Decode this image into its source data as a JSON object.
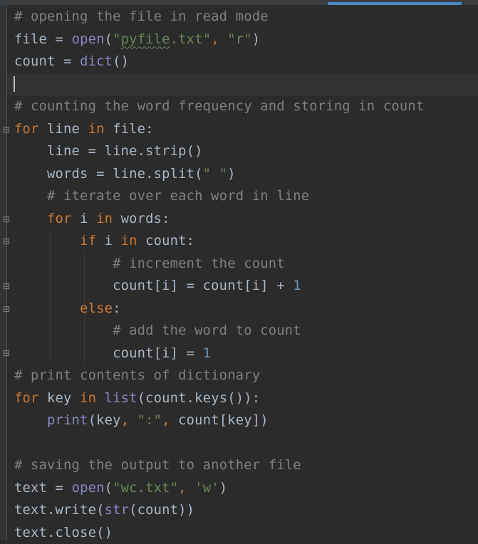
{
  "editor": {
    "language": "python",
    "theme": "dark",
    "lines": [
      {
        "id": "l1",
        "tokens": [
          {
            "t": "comment",
            "v": "# opening the file in read mode"
          }
        ]
      },
      {
        "id": "l2",
        "tokens": [
          {
            "t": "plain",
            "v": "file = "
          },
          {
            "t": "fn",
            "v": "open"
          },
          {
            "t": "plain",
            "v": "("
          },
          {
            "t": "str",
            "v": "\""
          },
          {
            "t": "str_sq",
            "v": "pyfile"
          },
          {
            "t": "str",
            "v": ".txt\""
          },
          {
            "t": "punct",
            "v": ", "
          },
          {
            "t": "str",
            "v": "\"r\""
          },
          {
            "t": "plain",
            "v": ")"
          }
        ]
      },
      {
        "id": "l3",
        "tokens": [
          {
            "t": "plain",
            "v": "count = "
          },
          {
            "t": "fn",
            "v": "dict"
          },
          {
            "t": "plain",
            "v": "()"
          }
        ]
      },
      {
        "id": "l4",
        "tokens": [
          {
            "t": "plain",
            "v": ""
          }
        ]
      },
      {
        "id": "l5",
        "tokens": [
          {
            "t": "comment",
            "v": "# counting the word frequency and storing in count"
          }
        ]
      },
      {
        "id": "l6",
        "tokens": [
          {
            "t": "kw",
            "v": "for "
          },
          {
            "t": "plain",
            "v": "line "
          },
          {
            "t": "kw",
            "v": "in "
          },
          {
            "t": "plain",
            "v": "file:"
          }
        ]
      },
      {
        "id": "l7",
        "tokens": [
          {
            "t": "plain",
            "v": "    line = line.strip()"
          }
        ]
      },
      {
        "id": "l8",
        "tokens": [
          {
            "t": "plain",
            "v": "    words = line.split("
          },
          {
            "t": "str",
            "v": "\" \""
          },
          {
            "t": "plain",
            "v": ")"
          }
        ]
      },
      {
        "id": "l9",
        "tokens": [
          {
            "t": "comment",
            "v": "    # iterate over each word in line"
          }
        ]
      },
      {
        "id": "l10",
        "tokens": [
          {
            "t": "plain",
            "v": "    "
          },
          {
            "t": "kw",
            "v": "for "
          },
          {
            "t": "plain",
            "v": "i "
          },
          {
            "t": "kw",
            "v": "in "
          },
          {
            "t": "plain",
            "v": "words:"
          }
        ]
      },
      {
        "id": "l11",
        "tokens": [
          {
            "t": "plain",
            "v": "        "
          },
          {
            "t": "kw",
            "v": "if "
          },
          {
            "t": "plain",
            "v": "i "
          },
          {
            "t": "kw",
            "v": "in "
          },
          {
            "t": "plain",
            "v": "count:"
          }
        ]
      },
      {
        "id": "l12",
        "tokens": [
          {
            "t": "comment",
            "v": "            # increment the count"
          }
        ]
      },
      {
        "id": "l13",
        "tokens": [
          {
            "t": "plain",
            "v": "            count[i] = count[i] + "
          },
          {
            "t": "num",
            "v": "1"
          }
        ]
      },
      {
        "id": "l14",
        "tokens": [
          {
            "t": "plain",
            "v": "        "
          },
          {
            "t": "kw",
            "v": "else"
          },
          {
            "t": "plain",
            "v": ":"
          }
        ]
      },
      {
        "id": "l15",
        "tokens": [
          {
            "t": "comment",
            "v": "            # add the word to count"
          }
        ]
      },
      {
        "id": "l16",
        "tokens": [
          {
            "t": "plain",
            "v": "            count[i] = "
          },
          {
            "t": "num",
            "v": "1"
          }
        ]
      },
      {
        "id": "l17",
        "tokens": [
          {
            "t": "comment",
            "v": "# print contents of dictionary"
          }
        ]
      },
      {
        "id": "l18",
        "tokens": [
          {
            "t": "kw",
            "v": "for "
          },
          {
            "t": "plain",
            "v": "key "
          },
          {
            "t": "kw",
            "v": "in "
          },
          {
            "t": "fn",
            "v": "list"
          },
          {
            "t": "plain",
            "v": "(count.keys()):"
          }
        ]
      },
      {
        "id": "l19",
        "tokens": [
          {
            "t": "plain",
            "v": "    "
          },
          {
            "t": "fn",
            "v": "print"
          },
          {
            "t": "plain",
            "v": "(key"
          },
          {
            "t": "punct",
            "v": ", "
          },
          {
            "t": "str",
            "v": "\":\""
          },
          {
            "t": "punct",
            "v": ", "
          },
          {
            "t": "plain",
            "v": "count[key])"
          }
        ]
      },
      {
        "id": "l20",
        "tokens": [
          {
            "t": "plain",
            "v": ""
          }
        ]
      },
      {
        "id": "l21",
        "tokens": [
          {
            "t": "comment",
            "v": "# saving the output to another file"
          }
        ]
      },
      {
        "id": "l22",
        "tokens": [
          {
            "t": "plain",
            "v": "text = "
          },
          {
            "t": "fn",
            "v": "open"
          },
          {
            "t": "plain",
            "v": "("
          },
          {
            "t": "str",
            "v": "\"wc.txt\""
          },
          {
            "t": "punct",
            "v": ", "
          },
          {
            "t": "str",
            "v": "'w'"
          },
          {
            "t": "plain",
            "v": ")"
          }
        ]
      },
      {
        "id": "l23",
        "tokens": [
          {
            "t": "plain",
            "v": "text.write("
          },
          {
            "t": "fn",
            "v": "str"
          },
          {
            "t": "plain",
            "v": "(count))"
          }
        ]
      },
      {
        "id": "l24",
        "tokens": [
          {
            "t": "plain",
            "v": "text.close()"
          }
        ]
      }
    ]
  },
  "colors": {
    "background": "#2b2b2b",
    "comment": "#808080",
    "keyword": "#cc7832",
    "builtin": "#8888c6",
    "string": "#6a8759",
    "number": "#6897bb",
    "text": "#a9b7c6",
    "scroll_indicator": "#4a88c7"
  }
}
